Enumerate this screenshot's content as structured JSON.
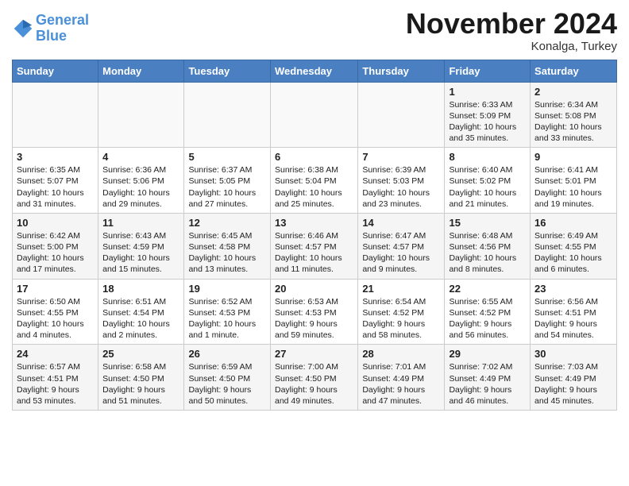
{
  "header": {
    "logo_line1": "General",
    "logo_line2": "Blue",
    "month": "November 2024",
    "location": "Konalga, Turkey"
  },
  "weekdays": [
    "Sunday",
    "Monday",
    "Tuesday",
    "Wednesday",
    "Thursday",
    "Friday",
    "Saturday"
  ],
  "weeks": [
    [
      {
        "day": "",
        "info": ""
      },
      {
        "day": "",
        "info": ""
      },
      {
        "day": "",
        "info": ""
      },
      {
        "day": "",
        "info": ""
      },
      {
        "day": "",
        "info": ""
      },
      {
        "day": "1",
        "info": "Sunrise: 6:33 AM\nSunset: 5:09 PM\nDaylight: 10 hours\nand 35 minutes."
      },
      {
        "day": "2",
        "info": "Sunrise: 6:34 AM\nSunset: 5:08 PM\nDaylight: 10 hours\nand 33 minutes."
      }
    ],
    [
      {
        "day": "3",
        "info": "Sunrise: 6:35 AM\nSunset: 5:07 PM\nDaylight: 10 hours\nand 31 minutes."
      },
      {
        "day": "4",
        "info": "Sunrise: 6:36 AM\nSunset: 5:06 PM\nDaylight: 10 hours\nand 29 minutes."
      },
      {
        "day": "5",
        "info": "Sunrise: 6:37 AM\nSunset: 5:05 PM\nDaylight: 10 hours\nand 27 minutes."
      },
      {
        "day": "6",
        "info": "Sunrise: 6:38 AM\nSunset: 5:04 PM\nDaylight: 10 hours\nand 25 minutes."
      },
      {
        "day": "7",
        "info": "Sunrise: 6:39 AM\nSunset: 5:03 PM\nDaylight: 10 hours\nand 23 minutes."
      },
      {
        "day": "8",
        "info": "Sunrise: 6:40 AM\nSunset: 5:02 PM\nDaylight: 10 hours\nand 21 minutes."
      },
      {
        "day": "9",
        "info": "Sunrise: 6:41 AM\nSunset: 5:01 PM\nDaylight: 10 hours\nand 19 minutes."
      }
    ],
    [
      {
        "day": "10",
        "info": "Sunrise: 6:42 AM\nSunset: 5:00 PM\nDaylight: 10 hours\nand 17 minutes."
      },
      {
        "day": "11",
        "info": "Sunrise: 6:43 AM\nSunset: 4:59 PM\nDaylight: 10 hours\nand 15 minutes."
      },
      {
        "day": "12",
        "info": "Sunrise: 6:45 AM\nSunset: 4:58 PM\nDaylight: 10 hours\nand 13 minutes."
      },
      {
        "day": "13",
        "info": "Sunrise: 6:46 AM\nSunset: 4:57 PM\nDaylight: 10 hours\nand 11 minutes."
      },
      {
        "day": "14",
        "info": "Sunrise: 6:47 AM\nSunset: 4:57 PM\nDaylight: 10 hours\nand 9 minutes."
      },
      {
        "day": "15",
        "info": "Sunrise: 6:48 AM\nSunset: 4:56 PM\nDaylight: 10 hours\nand 8 minutes."
      },
      {
        "day": "16",
        "info": "Sunrise: 6:49 AM\nSunset: 4:55 PM\nDaylight: 10 hours\nand 6 minutes."
      }
    ],
    [
      {
        "day": "17",
        "info": "Sunrise: 6:50 AM\nSunset: 4:55 PM\nDaylight: 10 hours\nand 4 minutes."
      },
      {
        "day": "18",
        "info": "Sunrise: 6:51 AM\nSunset: 4:54 PM\nDaylight: 10 hours\nand 2 minutes."
      },
      {
        "day": "19",
        "info": "Sunrise: 6:52 AM\nSunset: 4:53 PM\nDaylight: 10 hours\nand 1 minute."
      },
      {
        "day": "20",
        "info": "Sunrise: 6:53 AM\nSunset: 4:53 PM\nDaylight: 9 hours\nand 59 minutes."
      },
      {
        "day": "21",
        "info": "Sunrise: 6:54 AM\nSunset: 4:52 PM\nDaylight: 9 hours\nand 58 minutes."
      },
      {
        "day": "22",
        "info": "Sunrise: 6:55 AM\nSunset: 4:52 PM\nDaylight: 9 hours\nand 56 minutes."
      },
      {
        "day": "23",
        "info": "Sunrise: 6:56 AM\nSunset: 4:51 PM\nDaylight: 9 hours\nand 54 minutes."
      }
    ],
    [
      {
        "day": "24",
        "info": "Sunrise: 6:57 AM\nSunset: 4:51 PM\nDaylight: 9 hours\nand 53 minutes."
      },
      {
        "day": "25",
        "info": "Sunrise: 6:58 AM\nSunset: 4:50 PM\nDaylight: 9 hours\nand 51 minutes."
      },
      {
        "day": "26",
        "info": "Sunrise: 6:59 AM\nSunset: 4:50 PM\nDaylight: 9 hours\nand 50 minutes."
      },
      {
        "day": "27",
        "info": "Sunrise: 7:00 AM\nSunset: 4:50 PM\nDaylight: 9 hours\nand 49 minutes."
      },
      {
        "day": "28",
        "info": "Sunrise: 7:01 AM\nSunset: 4:49 PM\nDaylight: 9 hours\nand 47 minutes."
      },
      {
        "day": "29",
        "info": "Sunrise: 7:02 AM\nSunset: 4:49 PM\nDaylight: 9 hours\nand 46 minutes."
      },
      {
        "day": "30",
        "info": "Sunrise: 7:03 AM\nSunset: 4:49 PM\nDaylight: 9 hours\nand 45 minutes."
      }
    ]
  ]
}
